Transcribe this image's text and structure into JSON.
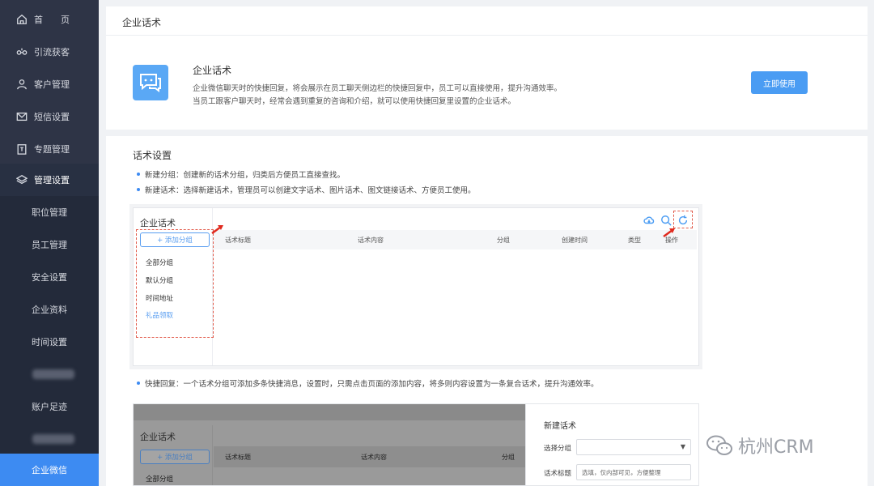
{
  "sidebar": {
    "items": [
      {
        "label": "首　　页",
        "icon": "home-icon"
      },
      {
        "label": "引流获客",
        "icon": "link-icon"
      },
      {
        "label": "客户管理",
        "icon": "user-icon"
      },
      {
        "label": "短信设置",
        "icon": "mail-icon"
      },
      {
        "label": "专题管理",
        "icon": "clipboard-icon"
      },
      {
        "label": "管理设置",
        "icon": "layers-icon"
      }
    ],
    "sub_items": [
      "职位管理",
      "员工管理",
      "安全设置",
      "企业资料",
      "时间设置",
      "",
      "账户足迹",
      "",
      "企业微信"
    ]
  },
  "page": {
    "title": "企业话术"
  },
  "intro": {
    "title": "企业话术",
    "line1": "企业微信聊天时的快捷回复，将会展示在员工聊天侧边栏的快捷回复中，员工可以直接使用，提升沟通效率。",
    "line2": "当员工跟客户聊天时，经常会遇到重复的咨询和介绍，就可以使用快捷回复里设置的企业话术。",
    "use_button": "立即使用",
    "icon": "chat-bubble-icon"
  },
  "settings": {
    "title": "话术设置",
    "bullet1": "新建分组：创建新的话术分组，归类后方便员工直接查找。",
    "bullet2": "新建话术：选择新建话术，管理员可以创建文字话术、图片话术、图文链接话术、方便员工使用。",
    "bullet3": "快捷回复：一个话术分组可添加多条快捷消息，设置时，只需点击页面的添加内容，将多则内容设置为一条复合话术，提升沟通效率。"
  },
  "shot1": {
    "title": "企业话术",
    "add_group": "+ 添加分组",
    "groups": [
      "全部分组",
      "默认分组",
      "时间地址",
      "礼品领取"
    ],
    "columns": [
      "话术标题",
      "话术内容",
      "分组",
      "创建时间",
      "类型",
      "操作"
    ],
    "tool_icons": [
      "cloud-download-icon",
      "search-icon",
      "refresh-icon"
    ]
  },
  "shot2": {
    "title": "企业话术",
    "add_group": "+ 添加分组",
    "group": "全部分组",
    "columns": [
      "话术标题",
      "话术内容",
      "分组"
    ],
    "form": {
      "title": "新建话术",
      "select_label": "选择分组",
      "select_value": "",
      "title_label": "话术标题",
      "title_placeholder": "选填，仅内部可见，方便整理"
    }
  },
  "watermark": {
    "text": "杭州CRM",
    "icon": "wechat-icon"
  }
}
